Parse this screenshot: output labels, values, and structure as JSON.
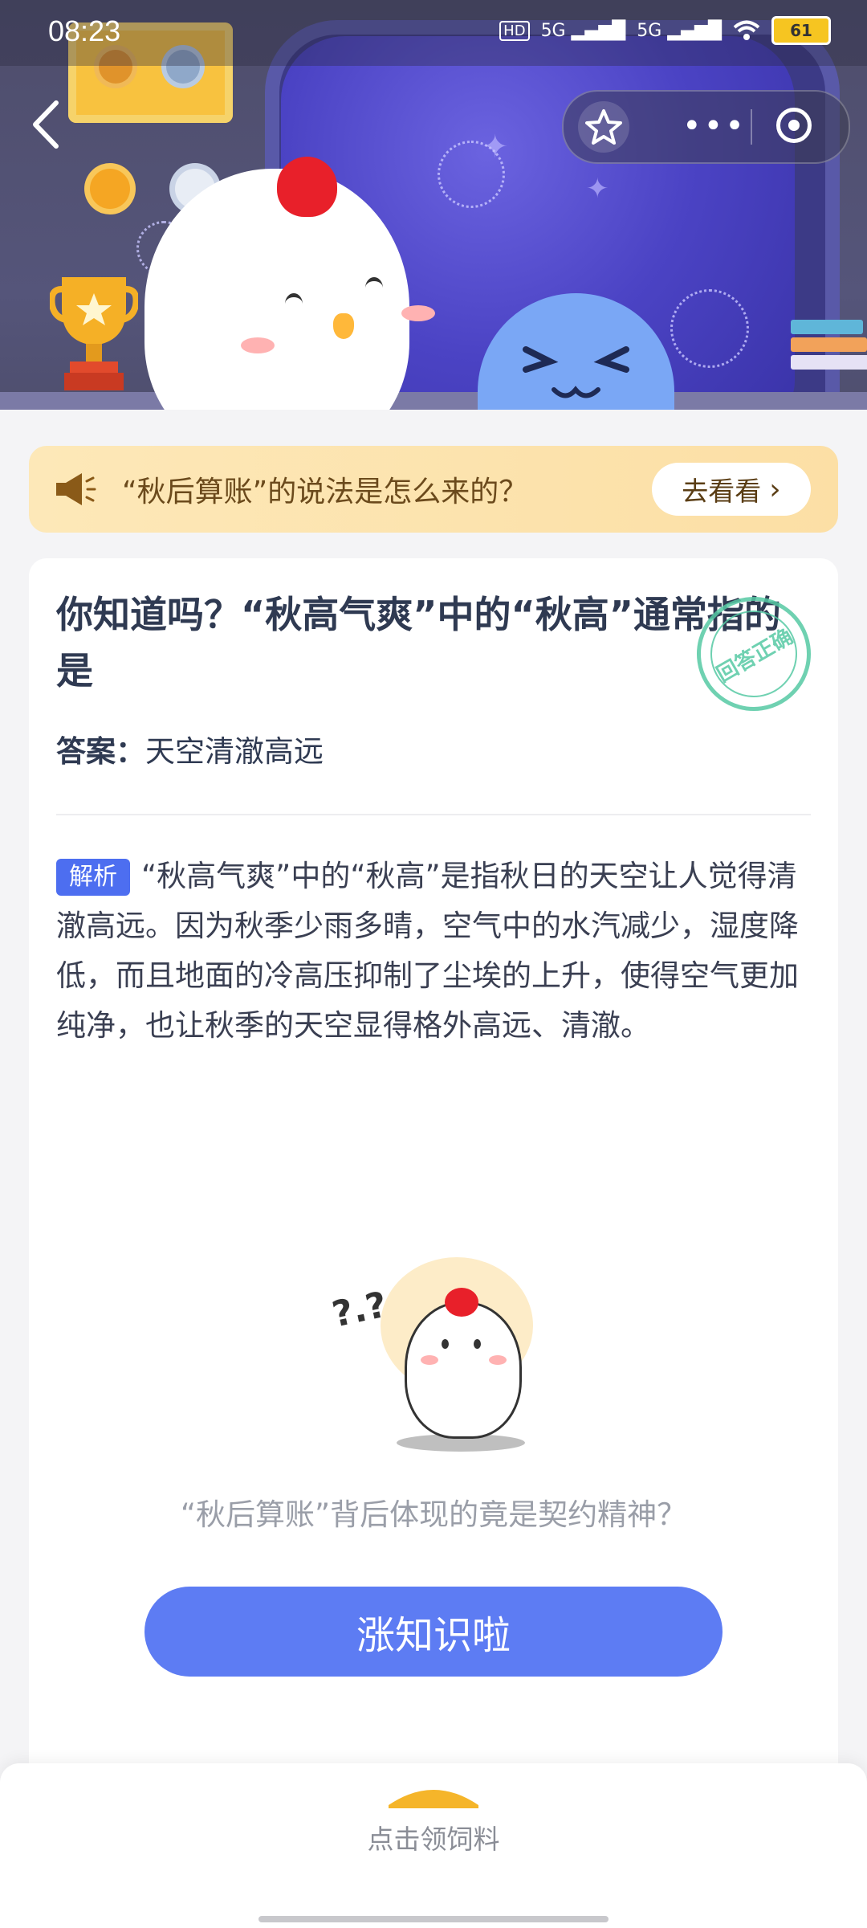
{
  "status_bar": {
    "time": "08:23",
    "signal_1": "5G",
    "signal_2": "5G",
    "hd": "HD",
    "battery": "61"
  },
  "nav": {
    "back_icon": "chevron-left-icon",
    "favorite_icon": "star-icon",
    "more_label": "•••",
    "record_icon": "record-icon"
  },
  "banner": {
    "text": "“秋后算账”的说法是怎么来的？",
    "button_label": "去看看",
    "button_chevron": "›"
  },
  "question": {
    "title": "你知道吗？“秋高气爽”中的“秋高”通常指的是",
    "stamp_text": "回答正确",
    "answer_label": "答案：",
    "answer_value": "天空清澈高远",
    "analysis_tag": "解析",
    "analysis_text": "“秋高气爽”中的“秋高”是指秋日的天空让人觉得清澈高远。因为秋季少雨多晴，空气中的水汽减少，湿度降低，而且地面的冷高压抑制了尘埃的上升，使得空气更加纯净，也让秋季的天空显得格外高远、清澈。"
  },
  "mascot": {
    "question_marks": "?.?"
  },
  "footer_card": {
    "hint": "“秋后算账”背后体现的竟是契约精神？",
    "cta_label": "涨知识啦"
  },
  "bottom_bar": {
    "label": "点击领饲料"
  },
  "colors": {
    "accent": "#5d7cf3",
    "tag": "#4d6ef0",
    "banner_bg": "#fde8b8",
    "stamp": "#56c9a4"
  }
}
